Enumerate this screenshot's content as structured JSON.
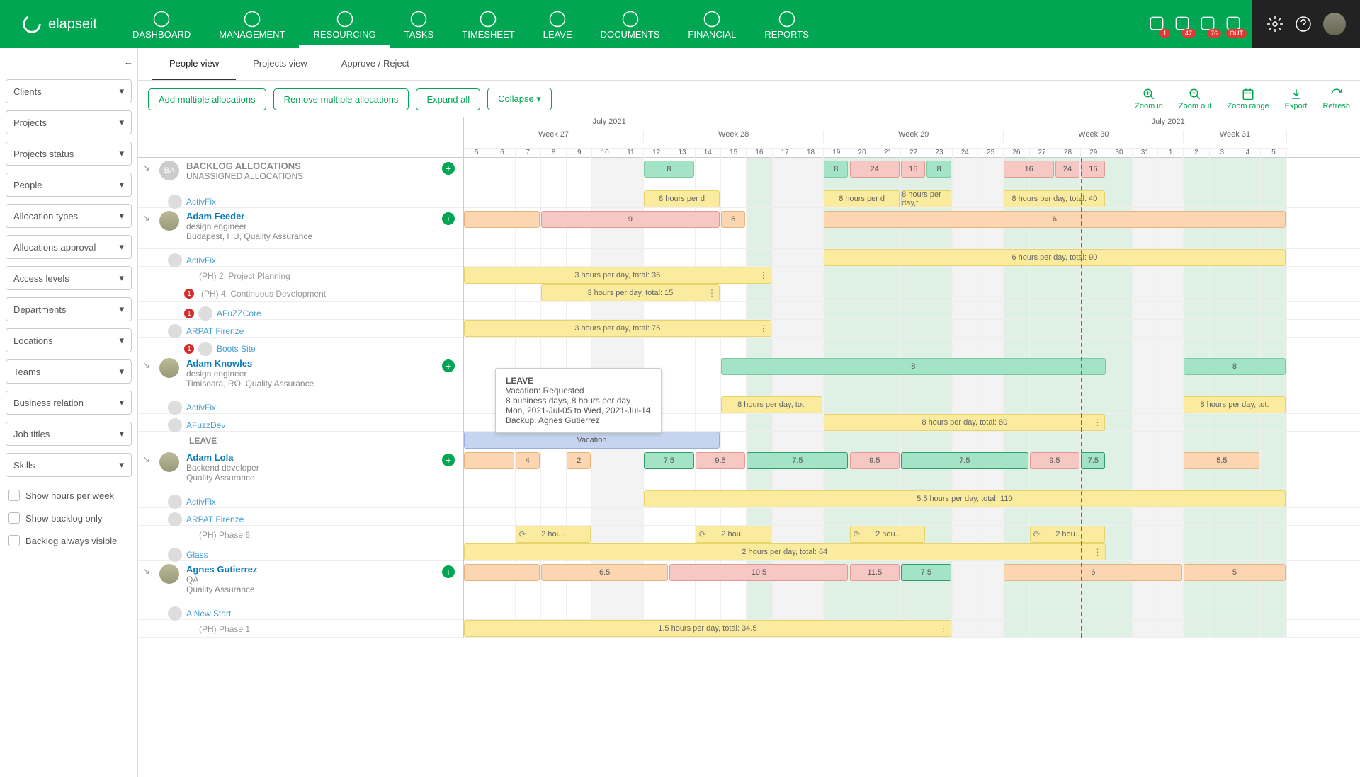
{
  "brand": "elapseit",
  "nav": [
    {
      "label": "DASHBOARD"
    },
    {
      "label": "MANAGEMENT"
    },
    {
      "label": "RESOURCING",
      "active": true
    },
    {
      "label": "TASKS"
    },
    {
      "label": "TIMESHEET"
    },
    {
      "label": "LEAVE"
    },
    {
      "label": "DOCUMENTS"
    },
    {
      "label": "FINANCIAL"
    },
    {
      "label": "REPORTS"
    }
  ],
  "badges": [
    {
      "name": "person-badge",
      "value": "1"
    },
    {
      "name": "time-badge",
      "value": "47"
    },
    {
      "name": "calendar-badge",
      "value": "76"
    },
    {
      "name": "hourglass-badge",
      "value": "OUT"
    }
  ],
  "tabs": [
    {
      "label": "People view",
      "active": true
    },
    {
      "label": "Projects view"
    },
    {
      "label": "Approve / Reject"
    }
  ],
  "buttons": {
    "add": "Add multiple allocations",
    "remove": "Remove multiple allocations",
    "expand": "Expand all",
    "collapse": "Collapse"
  },
  "zoom": {
    "in": "Zoom in",
    "out": "Zoom out",
    "range": "Zoom range",
    "export": "Export",
    "refresh": "Refresh"
  },
  "filters": [
    "Clients",
    "Projects",
    "Projects status",
    "People",
    "Allocation types",
    "Allocations approval",
    "Access levels",
    "Departments",
    "Locations",
    "Teams",
    "Business relation",
    "Job titles",
    "Skills"
  ],
  "checks": [
    "Show hours per week",
    "Show backlog only",
    "Backlog always visible"
  ],
  "timeline": {
    "month": "July 2021",
    "weeks": [
      "Week 27",
      "Week 28",
      "Week 29",
      "Week 30",
      "Week 31"
    ],
    "days": [
      "5",
      "6",
      "7",
      "8",
      "9",
      "10",
      "11",
      "12",
      "13",
      "14",
      "15",
      "16",
      "17",
      "18",
      "19",
      "20",
      "21",
      "22",
      "23",
      "24",
      "25",
      "26",
      "27",
      "28",
      "29",
      "30",
      "31",
      "1",
      "2",
      "3",
      "4",
      "5"
    ],
    "weekColSpan": [
      7,
      7,
      7,
      7,
      4
    ],
    "weekend_idx": [
      5,
      6,
      12,
      13,
      19,
      20,
      26,
      27
    ],
    "green_idx": [
      11,
      14,
      15,
      16,
      17,
      18,
      21,
      22,
      23,
      24,
      25,
      28,
      29,
      30,
      31
    ],
    "today_idx": 24
  },
  "rows": [
    {
      "type": "backlog",
      "avatar_text": "BA",
      "title": "BACKLOG ALLOCATIONS",
      "subtitle": "UNASSIGNED ALLOCATIONS",
      "bars": [
        {
          "cls": "green",
          "from": 7,
          "to": 9,
          "label": "8",
          "top": 0
        },
        {
          "cls": "green",
          "from": 14,
          "to": 15,
          "label": "8",
          "top": 0
        },
        {
          "cls": "red",
          "from": 15,
          "to": 17,
          "label": "24",
          "top": 0
        },
        {
          "cls": "red",
          "from": 17,
          "to": 18,
          "label": "16",
          "top": 0
        },
        {
          "cls": "green",
          "from": 18,
          "to": 19,
          "label": "8",
          "top": 0
        },
        {
          "cls": "red",
          "from": 21,
          "to": 23,
          "label": "16",
          "top": 0
        },
        {
          "cls": "red",
          "from": 23,
          "to": 24,
          "label": "24",
          "top": 0
        },
        {
          "cls": "red",
          "from": 24,
          "to": 25,
          "label": "16",
          "top": 0
        }
      ],
      "projects": [
        {
          "type": "link",
          "name": "ActivFix",
          "bars": [
            {
              "cls": "yellow",
              "from": 7,
              "to": 10,
              "label": "8 hours per d"
            },
            {
              "cls": "yellow",
              "from": 14,
              "to": 17,
              "label": "8 hours per d"
            },
            {
              "cls": "yellow",
              "from": 17,
              "to": 19,
              "label": "8 hours per day,t"
            },
            {
              "cls": "yellow",
              "from": 21,
              "to": 25,
              "label": "8 hours per day, total: 40"
            }
          ]
        }
      ]
    },
    {
      "type": "person",
      "name": "Adam Feeder",
      "role": "design engineer",
      "meta": "Budapest, HU, Quality Assurance",
      "bars": [
        {
          "cls": "orange",
          "from": 0,
          "to": 3,
          "label": "",
          "top": 0
        },
        {
          "cls": "red",
          "from": 3,
          "to": 10,
          "label": "9",
          "top": 0
        },
        {
          "cls": "orange",
          "from": 10,
          "to": 11,
          "label": "6",
          "top": 0
        },
        {
          "cls": "orange",
          "from": 14,
          "to": 32,
          "label": "6",
          "top": 0
        }
      ],
      "projects": [
        {
          "type": "link",
          "name": "ActivFix",
          "bars": [
            {
              "cls": "yellow",
              "from": 14,
              "to": 32,
              "label": "6 hours per day, total: 90"
            }
          ]
        },
        {
          "type": "text",
          "name": "(PH) 2. Project Planning",
          "bars": [
            {
              "cls": "yellow",
              "from": 0,
              "to": 12,
              "label": "3 hours per day, total: 36",
              "more": true
            }
          ]
        },
        {
          "type": "text",
          "name": "(PH) 4. Continuous Development",
          "alert": "1",
          "bars": [
            {
              "cls": "yellow",
              "from": 3,
              "to": 10,
              "label": "3 hours per day, total: 15",
              "more": true
            }
          ]
        },
        {
          "type": "link",
          "name": "AFuZZCore",
          "alert": "1"
        },
        {
          "type": "link",
          "name": "ARPAT Firenze",
          "bars": [
            {
              "cls": "yellow",
              "from": 0,
              "to": 12,
              "label": "3 hours per day, total: 75",
              "more": true
            }
          ]
        },
        {
          "type": "link",
          "name": "Boots Site",
          "alert": "1"
        }
      ]
    },
    {
      "type": "person",
      "name": "Adam Knowles",
      "role": "design engineer",
      "meta": "Timisoara, RO, Quality Assurance",
      "bars": [
        {
          "cls": "green",
          "from": 10,
          "to": 25,
          "label": "8",
          "top": 0
        },
        {
          "cls": "green",
          "from": 28,
          "to": 32,
          "label": "8",
          "top": 0
        }
      ],
      "projects": [
        {
          "type": "link",
          "name": "ActivFix",
          "bars": [
            {
              "cls": "yellow",
              "from": 10,
              "to": 14,
              "label": "8 hours per day, tot."
            },
            {
              "cls": "yellow",
              "from": 28,
              "to": 32,
              "label": "8 hours per day, tot."
            }
          ]
        },
        {
          "type": "link",
          "name": "AFuzzDev",
          "bars": [
            {
              "cls": "yellow",
              "from": 14,
              "to": 25,
              "label": "8 hours per day, total: 80",
              "more": true
            }
          ]
        },
        {
          "type": "leave",
          "name": "LEAVE",
          "bars": [
            {
              "cls": "blue",
              "from": 0,
              "to": 10,
              "label": "Vacation"
            }
          ]
        }
      ],
      "tooltip": {
        "title": "LEAVE",
        "l1": "Vacation: Requested",
        "l2": "8 business days, 8 hours per day",
        "l3": "Mon, 2021-Jul-05 to Wed, 2021-Jul-14",
        "l4": "Backup: Agnes Gutierrez"
      }
    },
    {
      "type": "person",
      "name": "Adam Lola",
      "role": "Backend developer",
      "meta": "Quality Assurance",
      "bars": [
        {
          "cls": "orange",
          "from": 0,
          "to": 2,
          "label": "",
          "top": 0
        },
        {
          "cls": "orange",
          "from": 2,
          "to": 3,
          "label": "4",
          "top": 0
        },
        {
          "cls": "orange",
          "from": 4,
          "to": 5,
          "label": "2",
          "top": 0
        },
        {
          "cls": "green-s",
          "from": 7,
          "to": 9,
          "label": "7.5",
          "top": 0
        },
        {
          "cls": "red",
          "from": 9,
          "to": 11,
          "label": "9.5",
          "top": 0
        },
        {
          "cls": "green-s",
          "from": 11,
          "to": 15,
          "label": "7.5",
          "top": 0
        },
        {
          "cls": "red",
          "from": 15,
          "to": 17,
          "label": "9.5",
          "top": 0
        },
        {
          "cls": "green-s",
          "from": 17,
          "to": 22,
          "label": "7.5",
          "top": 0
        },
        {
          "cls": "red",
          "from": 22,
          "to": 24,
          "label": "9.5",
          "top": 0
        },
        {
          "cls": "green-s",
          "from": 24,
          "to": 25,
          "label": "7.5",
          "top": 0
        },
        {
          "cls": "orange",
          "from": 28,
          "to": 31,
          "label": "5.5",
          "top": 0
        }
      ],
      "projects": [
        {
          "type": "link",
          "name": "ActivFix",
          "bars": [
            {
              "cls": "yellow",
              "from": 7,
              "to": 32,
              "label": "5.5 hours per day, total: 110"
            }
          ]
        },
        {
          "type": "link",
          "name": "ARPAT Firenze"
        },
        {
          "type": "text",
          "name": "(PH) Phase 6",
          "bars": [
            {
              "cls": "yellow",
              "from": 2,
              "to": 5,
              "label": "2 hou..",
              "recur": true
            },
            {
              "cls": "yellow",
              "from": 9,
              "to": 12,
              "label": "2 hou..",
              "recur": true
            },
            {
              "cls": "yellow",
              "from": 15,
              "to": 18,
              "label": "2 hou..",
              "recur": true
            },
            {
              "cls": "yellow",
              "from": 22,
              "to": 25,
              "label": "2 hou..",
              "recur": true
            }
          ]
        },
        {
          "type": "link",
          "name": "Glass",
          "bars": [
            {
              "cls": "yellow",
              "from": 0,
              "to": 25,
              "label": "2 hours per day, total: 64",
              "more": true
            }
          ]
        }
      ]
    },
    {
      "type": "person",
      "name": "Agnes Gutierrez",
      "role": "QA",
      "meta": "Quality Assurance",
      "bars": [
        {
          "cls": "orange",
          "from": 0,
          "to": 3,
          "label": "",
          "top": 0
        },
        {
          "cls": "orange",
          "from": 3,
          "to": 8,
          "label": "6.5",
          "top": 0
        },
        {
          "cls": "red",
          "from": 8,
          "to": 15,
          "label": "10.5",
          "top": 0
        },
        {
          "cls": "red",
          "from": 15,
          "to": 17,
          "label": "11.5",
          "top": 0
        },
        {
          "cls": "green-s",
          "from": 17,
          "to": 19,
          "label": "7.5",
          "top": 0
        },
        {
          "cls": "orange",
          "from": 21,
          "to": 28,
          "label": "6",
          "top": 0
        },
        {
          "cls": "orange",
          "from": 28,
          "to": 32,
          "label": "5",
          "top": 0
        }
      ],
      "projects": [
        {
          "type": "link",
          "name": "A New Start"
        },
        {
          "type": "text",
          "name": "(PH) Phase 1",
          "bars": [
            {
              "cls": "yellow",
              "from": 0,
              "to": 19,
              "label": "1.5 hours per day, total: 34.5",
              "more": true
            }
          ]
        }
      ]
    }
  ]
}
